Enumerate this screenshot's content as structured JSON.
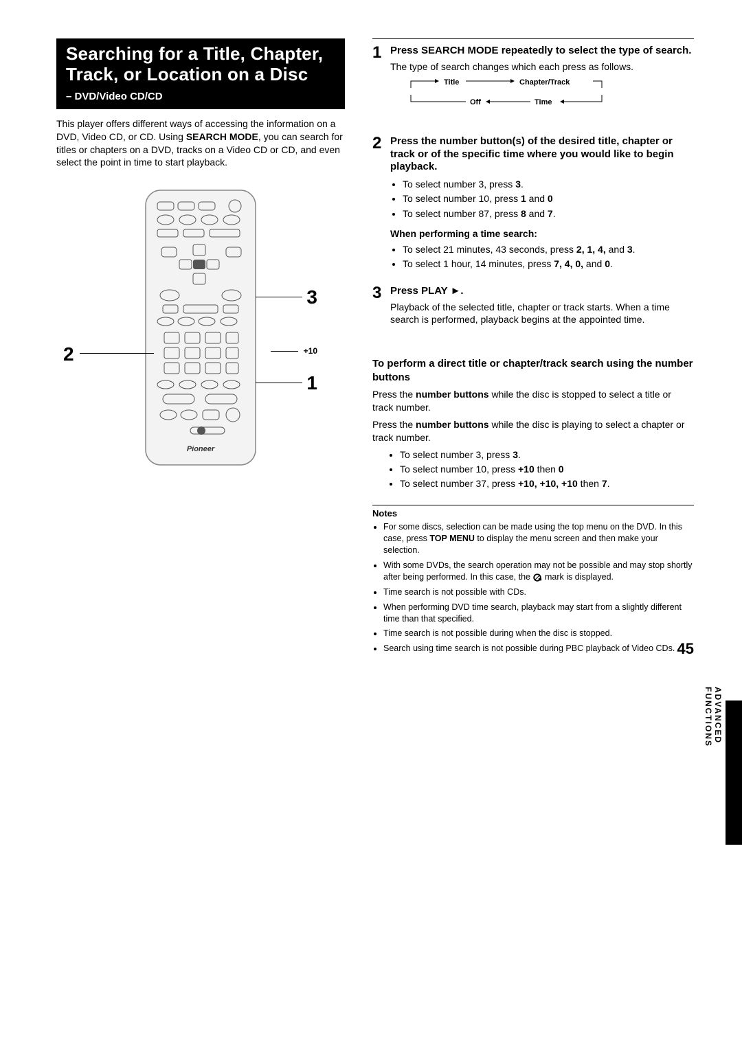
{
  "title": {
    "main": "Searching for a Title, Chapter, Track, or Location on a Disc",
    "sub": "– DVD/Video CD/CD"
  },
  "intro_parts": [
    "This player offers different ways of accessing the information on a DVD, Video CD, or CD. Using ",
    "SEARCH MODE",
    ", you can search for titles or chapters on a DVD, tracks on a Video CD or CD, and even select the point in time to start playback."
  ],
  "remote": {
    "callout_1": "1",
    "callout_2": "2",
    "callout_3": "3",
    "plus10": "+10",
    "brand": "Pioneer"
  },
  "cycle": {
    "title": "Title",
    "chapter": "Chapter/Track",
    "time": "Time",
    "off": "Off"
  },
  "steps": [
    {
      "num": "1",
      "title": "Press SEARCH MODE repeatedly to select the type of search.",
      "desc": "The type of search changes which each press as follows."
    },
    {
      "num": "2",
      "title": "Press the number button(s) of the desired title, chapter or track or of the specific time where you would like to begin playback.",
      "bullets": [
        [
          "To select number 3, press ",
          "3",
          "."
        ],
        [
          "To select number 10, press ",
          "1",
          " and ",
          "0"
        ],
        [
          "To select number 87, press ",
          "8",
          " and ",
          "7",
          "."
        ]
      ],
      "subhead": "When performing a time search:",
      "bullets2": [
        [
          "To select  21 minutes, 43 seconds, press ",
          "2, 1, 4,",
          " and ",
          "3",
          "."
        ],
        [
          "To select 1 hour, 14 minutes, press ",
          "7, 4, 0,",
          " and ",
          "0",
          "."
        ]
      ]
    },
    {
      "num": "3",
      "title_parts": [
        "Press PLAY ",
        "►",
        "."
      ],
      "desc": "Playback of the selected title, chapter or track starts. When a time search is performed, playback begins at the appointed time."
    }
  ],
  "direct": {
    "title": "To perform a direct title or chapter/track search using the number buttons",
    "p1_parts": [
      "Press the ",
      "number buttons",
      " while the disc is stopped to select a title or track number."
    ],
    "p2_parts": [
      "Press the ",
      "number buttons",
      " while the disc is playing to select a chapter or track number."
    ],
    "bullets": [
      [
        "To select number 3, press ",
        "3",
        "."
      ],
      [
        "To select number 10, press ",
        "+10",
        " then ",
        "0"
      ],
      [
        "To select number 37, press ",
        "+10, +10, +10",
        " then ",
        "7",
        "."
      ]
    ]
  },
  "notes": {
    "head": "Notes",
    "items": [
      [
        "For some discs, selection can be made using the top menu on the DVD. In this case, press ",
        "TOP MENU",
        " to display the menu screen and then make your selection."
      ],
      [
        "With some DVDs, the search operation may not be possible and may stop shortly after being performed. In this case, the ",
        "__ICON__",
        " mark is displayed."
      ],
      [
        "Time search is not possible with CDs."
      ],
      [
        "When performing DVD time search, playback may start from a slightly different time than that specified."
      ],
      [
        "Time search is not possible during when the disc is stopped."
      ],
      [
        "Search using time search is not possible during PBC playback of Video CDs."
      ]
    ]
  },
  "side_label": "ADVANCED  FUNCTIONS",
  "page_number": "45"
}
